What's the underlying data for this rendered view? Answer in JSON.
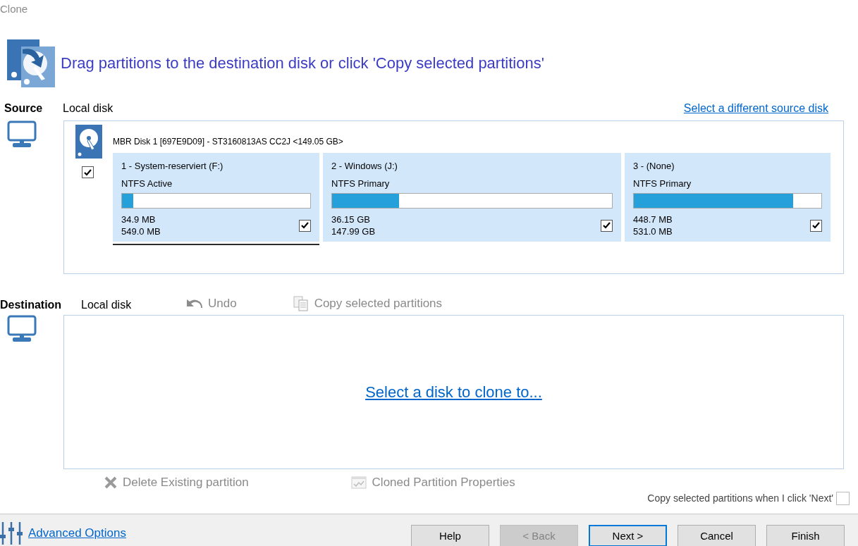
{
  "window": {
    "title": "Clone"
  },
  "instruction": "Drag partitions to the destination disk or click 'Copy selected partitions'",
  "source": {
    "label": "Source",
    "disk_type": "Local disk",
    "change_link": "Select a different source disk",
    "disk": {
      "title": "MBR Disk 1 [697E9D09] - ST3160813AS CC2J  <149.05 GB>",
      "checked": true,
      "partitions": [
        {
          "name": "1 - System-reserviert (F:)",
          "type": "NTFS Active",
          "level": 0.06,
          "used": "34.9 MB",
          "total": "549.0 MB",
          "checked": true,
          "selected": true
        },
        {
          "name": "2 - Windows (J:)",
          "type": "NTFS Primary",
          "level": 0.24,
          "used": "36.15 GB",
          "total": "147.99 GB",
          "checked": true,
          "selected": false
        },
        {
          "name": "3 -  (None)",
          "type": "NTFS Primary",
          "level": 0.85,
          "used": "448.7 MB",
          "total": "531.0 MB",
          "checked": true,
          "selected": false
        }
      ]
    }
  },
  "destination": {
    "label": "Destination",
    "disk_type": "Local disk",
    "actions": [
      {
        "kind": "undo",
        "label": "Undo",
        "disabled": true
      },
      {
        "kind": "copy",
        "label": "Copy selected partitions",
        "disabled": true
      }
    ],
    "select_link": "Select a disk to clone to...",
    "bottom_actions": [
      {
        "kind": "delete",
        "label": "Delete Existing partition",
        "disabled": true
      },
      {
        "kind": "properties",
        "label": "Cloned Partition Properties",
        "disabled": true
      }
    ]
  },
  "copy_on_next": {
    "label": "Copy selected partitions when I click 'Next'",
    "checked": false
  },
  "advanced_options": "Advanced Options",
  "buttons": [
    {
      "label": "Help",
      "disabled": false,
      "default": false
    },
    {
      "label": "< Back",
      "disabled": true,
      "default": false
    },
    {
      "label": "Next >",
      "disabled": false,
      "default": true
    },
    {
      "label": "Cancel",
      "disabled": false,
      "default": false
    },
    {
      "label": "Finish",
      "disabled": false,
      "default": false
    }
  ]
}
